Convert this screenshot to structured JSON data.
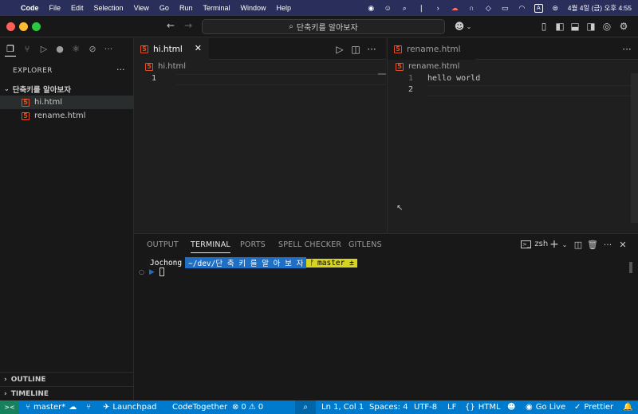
{
  "menubar": {
    "apple": "",
    "app_name": "Code",
    "items": [
      "File",
      "Edit",
      "Selection",
      "View",
      "Go",
      "Run",
      "Terminal",
      "Window",
      "Help"
    ],
    "clock": "4월 4일 (금) 오후 4:55",
    "input_indicator": "A"
  },
  "titlebar": {
    "search_text": "단축키를 알아보자",
    "nav_back": "←",
    "nav_forward": "→"
  },
  "sidebar": {
    "title": "EXPLORER",
    "more": "···",
    "folder": "단축키를 알아보자",
    "files": [
      "hi.html",
      "rename.html"
    ],
    "outline": "OUTLINE",
    "timeline": "TIMELINE"
  },
  "editor_left": {
    "tab_label": "hi.html",
    "breadcrumb": "hi.html",
    "lines": [
      {
        "num": "1",
        "text": ""
      }
    ]
  },
  "editor_right": {
    "tab_label": "rename.html",
    "breadcrumb": "rename.html",
    "lines": [
      {
        "num": "1",
        "text": "hello world"
      },
      {
        "num": "2",
        "text": ""
      }
    ]
  },
  "panel": {
    "tabs": [
      "OUTPUT",
      "TERMINAL",
      "PORTS",
      "SPELL CHECKER",
      "GITLENS"
    ],
    "active_tab": "TERMINAL",
    "shell": "zsh",
    "prompt_user": "Jochong",
    "prompt_path": "~/dev/단 축 키 를  알 아 보 자",
    "prompt_branch": "master ±"
  },
  "statusbar": {
    "remote_icon": "><",
    "branch": "master*",
    "launchpad": "Launchpad",
    "codetogether": "CodeTogether",
    "errors": "0",
    "warnings": "0",
    "position": "Ln 1, Col 1",
    "spaces": "Spaces: 4",
    "encoding": "UTF-8",
    "eol": "LF",
    "language": "HTML",
    "golive": "Go Live",
    "prettier": "Prettier"
  },
  "colors": {
    "statusbar_bg": "#007acc",
    "menubar_bg": "#2a2e5a",
    "html_icon": "#e44d26",
    "prompt_path_bg": "#1f6fc5",
    "prompt_branch_bg": "#d7d41e"
  }
}
